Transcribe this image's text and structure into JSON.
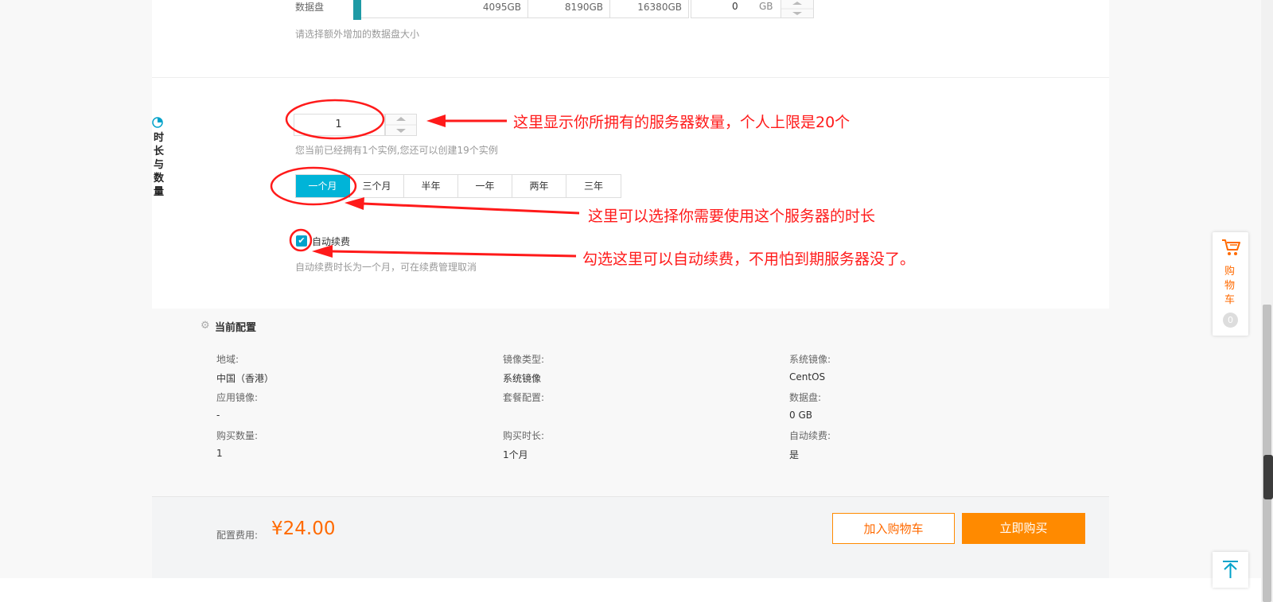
{
  "disk": {
    "label": "数据盘",
    "ticks": [
      "4095GB",
      "8190GB",
      "16380GB"
    ],
    "value": "0",
    "unit": "GB",
    "hint": "请选择额外增加的数据盘大小"
  },
  "section": {
    "label_chars": [
      "时",
      "长",
      "与",
      "数",
      "量"
    ]
  },
  "quantity": {
    "value": "1",
    "hint": "您当前已经拥有1个实例,您还可以创建19个实例"
  },
  "duration": {
    "tabs": [
      "一个月",
      "三个月",
      "半年",
      "一年",
      "两年",
      "三年"
    ],
    "selected": "一个月"
  },
  "autorenew": {
    "label": "自动续费",
    "checked": true,
    "hint": "自动续费时长为一个月，可在续费管理取消"
  },
  "annotations": {
    "quantity": "这里显示你所拥有的服务器数量，个人上限是20个",
    "duration": "这里可以选择你需要使用这个服务器的时长",
    "autorenew": "勾选这里可以自动续费，不用怕到期服务器没了。",
    "color": "#ff1a1a"
  },
  "config": {
    "title": "当前配置",
    "items": [
      {
        "key": "地域:",
        "value": "中国（香港）"
      },
      {
        "key": "镜像类型:",
        "value": "系统镜像"
      },
      {
        "key": "系统镜像:",
        "value": "CentOS"
      },
      {
        "key": "应用镜像:",
        "value": "-"
      },
      {
        "key": "套餐配置:",
        "value": ""
      },
      {
        "key": "数据盘:",
        "value": "0 GB"
      },
      {
        "key": "购买数量:",
        "value": "1"
      },
      {
        "key": "购买时长:",
        "value": "1个月"
      },
      {
        "key": "自动续费:",
        "value": "是"
      }
    ]
  },
  "footer": {
    "price_label": "配置费用:",
    "price": "¥24.00",
    "add_cart": "加入购物车",
    "buy_now": "立即购买"
  },
  "float_cart": {
    "chars": [
      "购",
      "物",
      "车"
    ],
    "count": "0"
  },
  "colors": {
    "accent": "#00b4d8",
    "orange": "#ff8a00",
    "price": "#ff6a00"
  }
}
